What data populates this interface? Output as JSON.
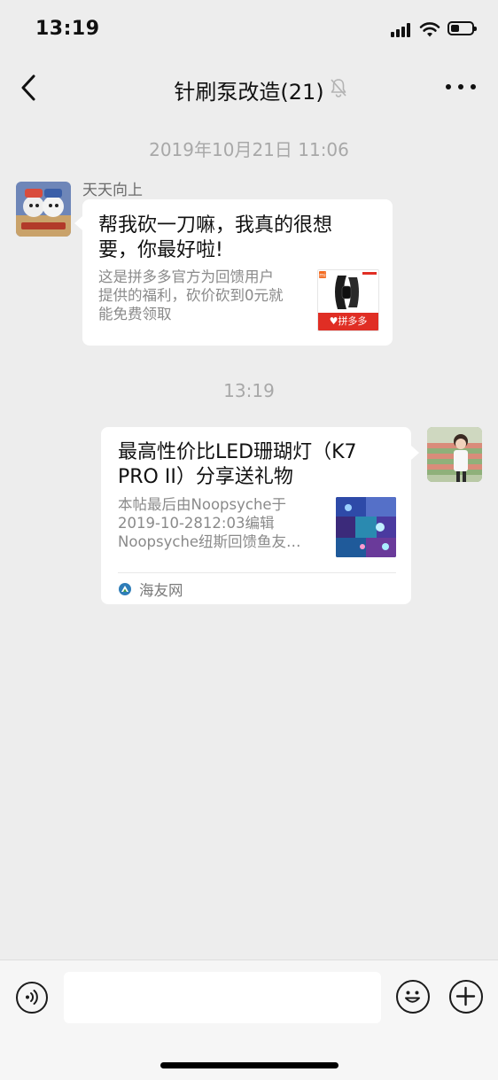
{
  "status_bar": {
    "time": "13:19"
  },
  "nav": {
    "title": "针刷泵改造(21)",
    "back_icon": "chevron-left-icon",
    "mute_icon": "bell-slash-icon",
    "more_icon": "ellipsis-icon"
  },
  "messages": [
    {
      "timestamp": "2019年10月21日 11:06",
      "sender": "天天向上",
      "side": "left",
      "card": {
        "title": "帮我砍一刀嘛，我真的很想要，你最好啦!",
        "title_lines": [
          "帮我砍一刀嘛，我真的很想",
          "要，你最好啦!"
        ],
        "desc_lines": [
          "这是拼多多官方为回馈用户",
          "提供的福利，砍价砍到0元就",
          "能免费领取"
        ],
        "thumb_badge": "拼多多",
        "thumb_corner": "mi"
      }
    },
    {
      "timestamp": "13:19",
      "side": "right",
      "card": {
        "title_lines": [
          "最高性价比LED珊瑚灯（K7",
          "PRO II）分享送礼物"
        ],
        "desc_lines": [
          "本帖最后由Noopsyche于",
          "2019-10-2812:03编辑",
          "Noopsyche纽斯回馈鱼友…"
        ],
        "source": "海友网"
      }
    }
  ],
  "colors": {
    "background": "#ededed",
    "bubble": "#ffffff",
    "timestamp": "#a8a8a8",
    "pdd_red": "#e02e24"
  },
  "input_bar": {
    "voice_icon": "voice-icon",
    "emoji_icon": "emoji-icon",
    "plus_icon": "plus-icon",
    "input_value": ""
  }
}
